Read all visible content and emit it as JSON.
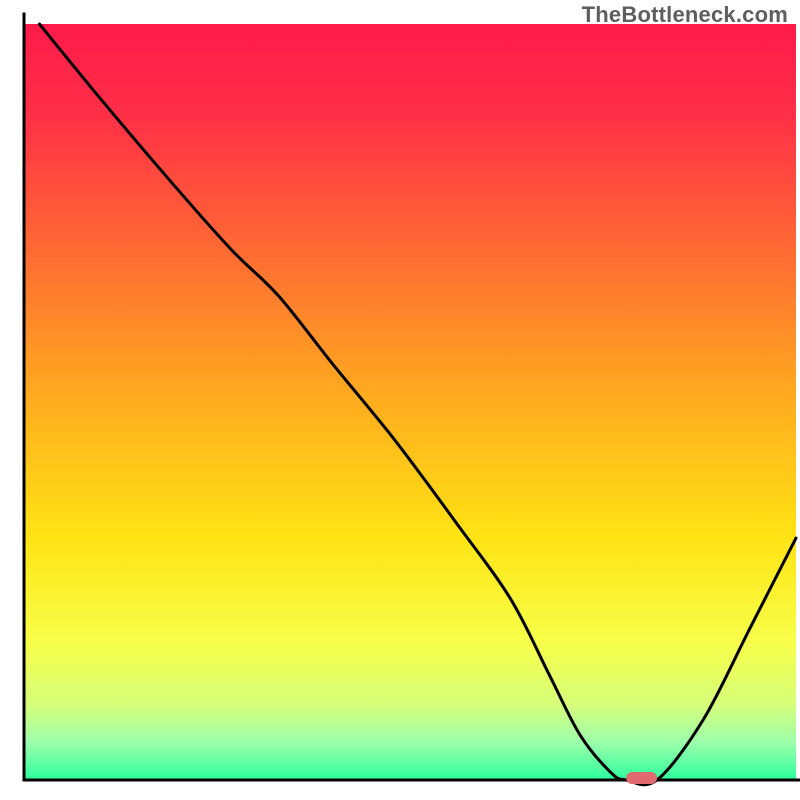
{
  "watermark": "TheBottleneck.com",
  "chart_data": {
    "type": "line",
    "title": "",
    "xlabel": "",
    "ylabel": "",
    "xlim": [
      0,
      100
    ],
    "ylim": [
      0,
      100
    ],
    "series": [
      {
        "name": "bottleneck-curve",
        "x": [
          2,
          10,
          20,
          27,
          33,
          40,
          48,
          56,
          63,
          68,
          72,
          76,
          78,
          82,
          88,
          94,
          100
        ],
        "y": [
          100,
          90,
          78,
          70,
          64,
          55,
          45,
          34,
          24,
          14,
          6,
          1,
          0,
          0,
          8,
          20,
          32
        ]
      }
    ],
    "marker": {
      "name": "optimal-range",
      "x_start": 78,
      "x_end": 82,
      "y": 0,
      "color": "#e06a6f"
    },
    "axes": {
      "color": "#000000",
      "thickness": 3
    },
    "gradient_stops": [
      {
        "offset": 0.0,
        "color": "#ff1b4a"
      },
      {
        "offset": 0.12,
        "color": "#ff2f47"
      },
      {
        "offset": 0.3,
        "color": "#ff6a33"
      },
      {
        "offset": 0.5,
        "color": "#ffad1e"
      },
      {
        "offset": 0.68,
        "color": "#ffe414"
      },
      {
        "offset": 0.82,
        "color": "#f7ff4a"
      },
      {
        "offset": 0.9,
        "color": "#d6ff7a"
      },
      {
        "offset": 0.95,
        "color": "#9dffab"
      },
      {
        "offset": 1.0,
        "color": "#2bff9d"
      }
    ]
  }
}
